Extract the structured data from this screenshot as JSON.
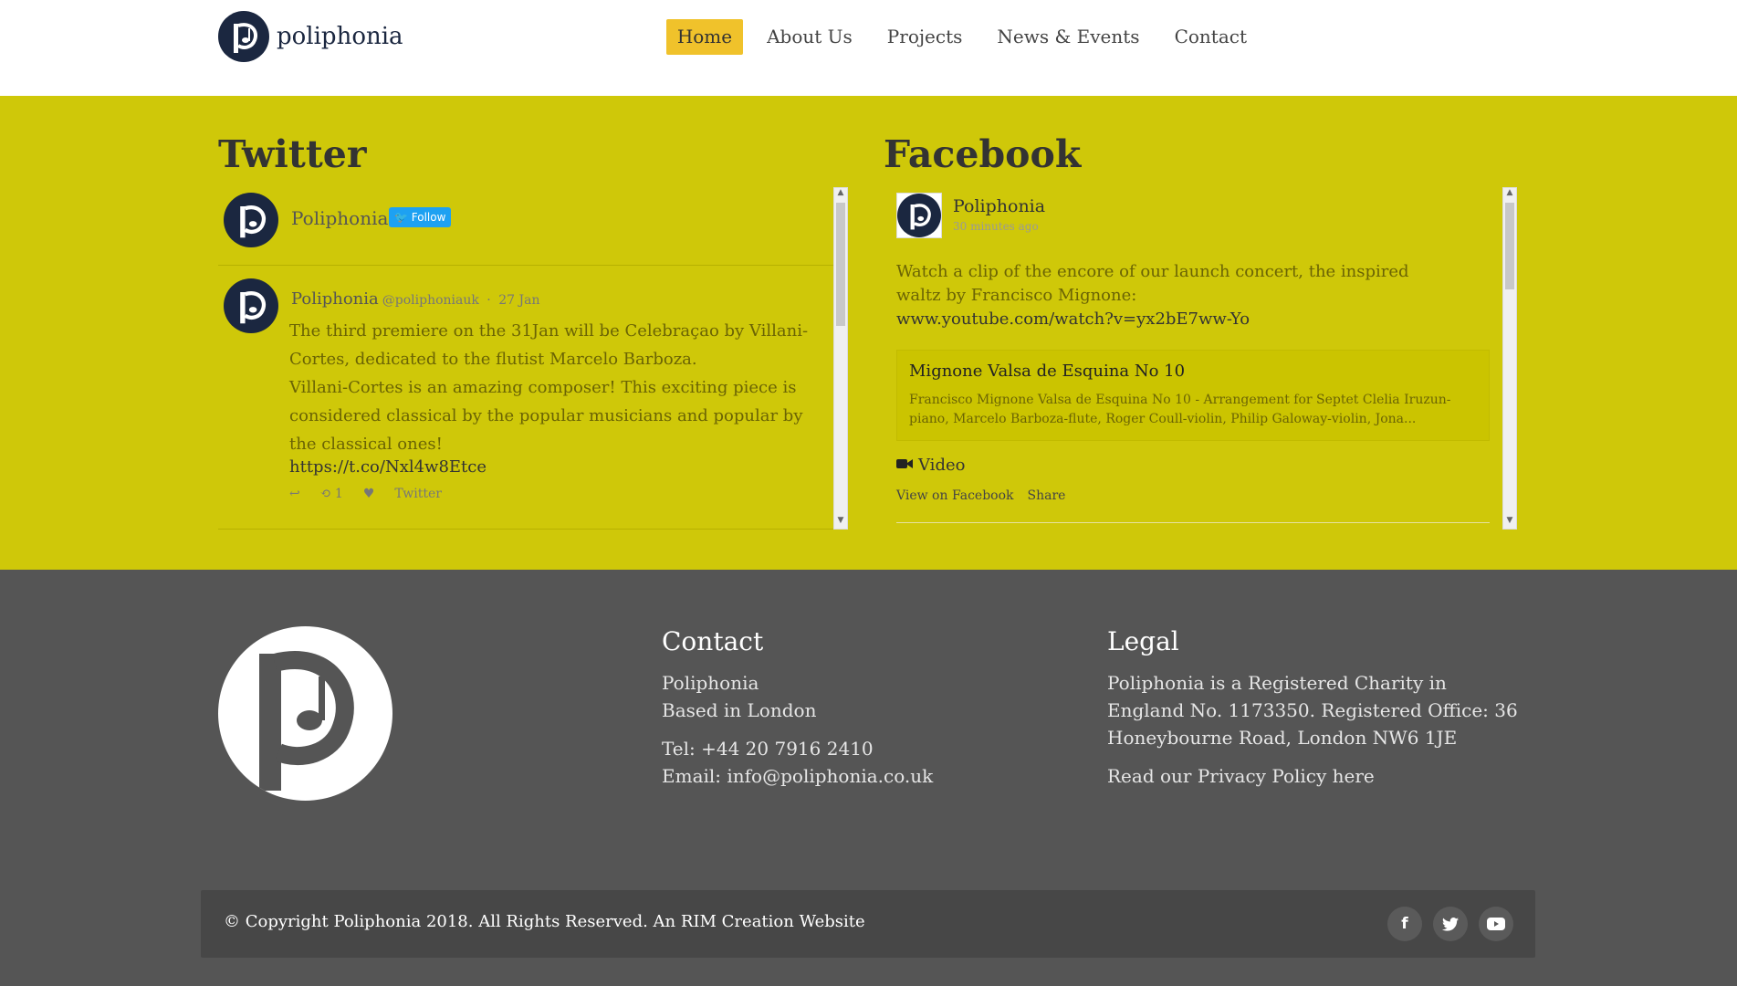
{
  "header": {
    "logo_text": "poliphonia",
    "nav": [
      {
        "label": "Home",
        "active": true
      },
      {
        "label": "About Us",
        "active": false
      },
      {
        "label": "Projects",
        "active": false
      },
      {
        "label": "News & Events",
        "active": false
      },
      {
        "label": "Contact",
        "active": false
      }
    ]
  },
  "twitter": {
    "title": "Twitter",
    "account_name": "Poliphonia",
    "follow_label": "Follow",
    "tweet": {
      "name": "Poliphonia",
      "handle": "@poliphoniauk",
      "date": "27 Jan",
      "text_1": "The third premiere on the 31Jan will be Celebraçao by Villani-Cortes, dedicated to the flutist Marcelo Barboza.",
      "text_2": "Villani-Cortes is an amazing composer! This exciting piece is considered classical by the popular musicians and popular by the classical ones!",
      "link": "https://t.co/Nxl4w8Etce",
      "retweet_count": "1",
      "source": "Twitter"
    }
  },
  "facebook": {
    "title": "Facebook",
    "page_name": "Poliphonia",
    "time_ago": "30 minutes ago",
    "post_text": "Watch a clip of the encore of our launch concert, the inspired waltz by Francisco Mignone:",
    "post_link": "www.youtube.com/watch?v=yx2bE7ww-Yo",
    "card_title": "Mignone Valsa de Esquina No 10",
    "card_desc": "Francisco Mignone Valsa de Esquina No 10 - Arrangement for Septet Clelia Iruzun-piano, Marcelo Barboza-flute, Roger Coull-violin, Philip Galoway-violin, Jona...",
    "video_label": "Video",
    "view_label": "View on Facebook",
    "share_label": "Share"
  },
  "footer": {
    "contact": {
      "title": "Contact",
      "line1": "Poliphonia",
      "line2": "Based in London",
      "tel": "Tel: +44 20 7916 2410",
      "email": "Email: info@poliphonia.co.uk"
    },
    "legal": {
      "title": "Legal",
      "text": "Poliphonia is a Registered Charity in England No. 1173350. Registered Office: 36 Honeybourne Road, London NW6 1JE",
      "privacy": "Read our Privacy Policy here"
    },
    "copyright": "© Copyright Poliphonia 2018. All Rights Reserved. An RIM Creation Website",
    "social": [
      "facebook-icon",
      "twitter-icon",
      "youtube-icon"
    ]
  },
  "colors": {
    "accent_yellow": "#cfc809",
    "nav_active": "#f0c22b",
    "brand_navy": "#1b2740",
    "footer_bg": "#555555"
  }
}
